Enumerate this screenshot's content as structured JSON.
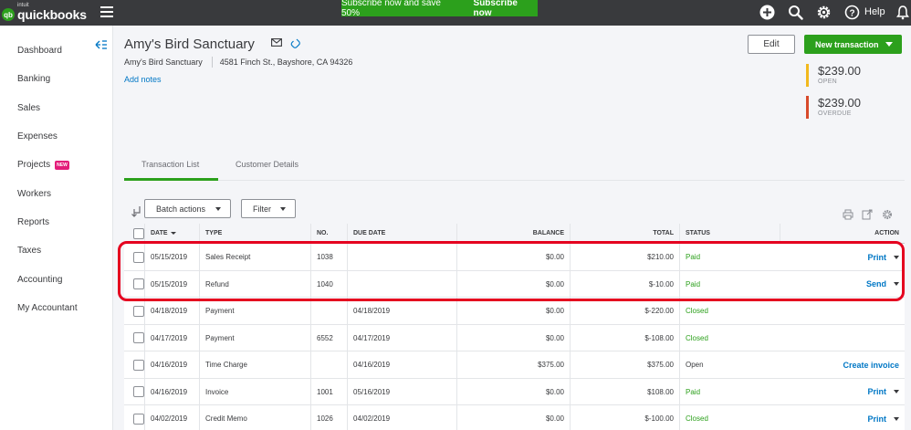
{
  "topbar": {
    "logo_intuit": "intuit",
    "logo_name": "quickbooks",
    "logo_mark": "qb",
    "promo_text": "Subscribe now and save 50%",
    "promo_button": "Subscribe now",
    "help_label": "Help",
    "icons": [
      "plus-icon",
      "search-icon",
      "gear-icon",
      "help-icon",
      "bell-icon"
    ]
  },
  "sidebar": {
    "items": [
      {
        "label": "Dashboard"
      },
      {
        "label": "Banking"
      },
      {
        "label": "Sales"
      },
      {
        "label": "Expenses"
      },
      {
        "label": "Projects",
        "badge": "NEW"
      },
      {
        "label": "Workers"
      },
      {
        "label": "Reports"
      },
      {
        "label": "Taxes"
      },
      {
        "label": "Accounting"
      },
      {
        "label": "My Accountant"
      }
    ]
  },
  "customer": {
    "name": "Amy's Bird Sanctuary",
    "company": "Amy's Bird Sanctuary",
    "address": "4581 Finch St., Bayshore, CA 94326",
    "add_notes": "Add notes"
  },
  "header_actions": {
    "edit": "Edit",
    "new_transaction": "New transaction"
  },
  "summary": {
    "open": {
      "amount": "$239.00",
      "label": "OPEN",
      "color": "#f2b91d"
    },
    "overdue": {
      "amount": "$239.00",
      "label": "OVERDUE",
      "color": "#d84a2b"
    }
  },
  "tabs": [
    {
      "label": "Transaction List",
      "active": true
    },
    {
      "label": "Customer Details",
      "active": false
    }
  ],
  "toolbar": {
    "batch_actions": "Batch actions",
    "filter": "Filter"
  },
  "table": {
    "columns": [
      "DATE",
      "TYPE",
      "NO.",
      "DUE DATE",
      "BALANCE",
      "TOTAL",
      "STATUS",
      "ACTION"
    ],
    "rows": [
      {
        "date": "05/15/2019",
        "type": "Sales Receipt",
        "no": "1038",
        "due": "",
        "balance": "$0.00",
        "total": "$210.00",
        "status": "Paid",
        "action": "Print"
      },
      {
        "date": "05/15/2019",
        "type": "Refund",
        "no": "1040",
        "due": "",
        "balance": "$0.00",
        "total": "$-10.00",
        "status": "Paid",
        "action": "Send"
      },
      {
        "date": "04/18/2019",
        "type": "Payment",
        "no": "",
        "due": "04/18/2019",
        "balance": "$0.00",
        "total": "$-220.00",
        "status": "Closed",
        "action": ""
      },
      {
        "date": "04/17/2019",
        "type": "Payment",
        "no": "6552",
        "due": "04/17/2019",
        "balance": "$0.00",
        "total": "$-108.00",
        "status": "Closed",
        "action": ""
      },
      {
        "date": "04/16/2019",
        "type": "Time Charge",
        "no": "",
        "due": "04/16/2019",
        "balance": "$375.00",
        "total": "$375.00",
        "status": "Open",
        "action": "Create invoice"
      },
      {
        "date": "04/16/2019",
        "type": "Invoice",
        "no": "1001",
        "due": "05/16/2019",
        "balance": "$0.00",
        "total": "$108.00",
        "status": "Paid",
        "action": "Print"
      },
      {
        "date": "04/02/2019",
        "type": "Credit Memo",
        "no": "1026",
        "due": "04/02/2019",
        "balance": "$0.00",
        "total": "$-100.00",
        "status": "Closed",
        "action": "Print"
      }
    ]
  }
}
